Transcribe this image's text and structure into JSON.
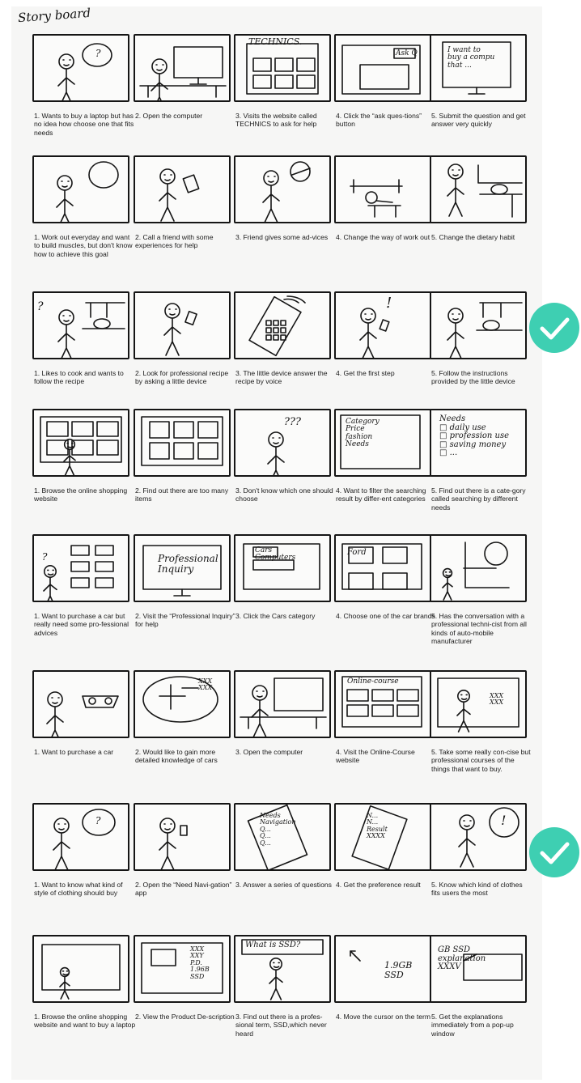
{
  "title": "Story board",
  "rows": [
    {
      "panels": [
        {
          "caption": "1. Wants to buy a laptop but has no idea how choose one that fits needs",
          "text": "?"
        },
        {
          "caption": "2. Open the computer",
          "text": ""
        },
        {
          "caption": "3. Visits the website called TECHNICS to ask for help",
          "text": "TECHNICS."
        },
        {
          "caption": "4. Click the “ask ques-tions” button",
          "text": "Ask Q"
        },
        {
          "caption": "5. Submit the question and get answer very quickly",
          "text": "I want to\nbuy a compu\nthat ..."
        }
      ]
    },
    {
      "panels": [
        {
          "caption": "1. Work out everyday and want to build  muscles, but don't know how to achieve this goal",
          "text": ""
        },
        {
          "caption": "2. Call a friend with some experiences for help",
          "text": ""
        },
        {
          "caption": "3. Friend gives some ad-vices",
          "text": ""
        },
        {
          "caption": "4. Change the way of work out",
          "text": ""
        },
        {
          "caption": "5. Change the dietary habit",
          "text": ""
        }
      ]
    },
    {
      "panels": [
        {
          "caption": "1. Likes to cook and wants to follow the recipe",
          "text": "?"
        },
        {
          "caption": "2. Look for professional recipe by asking a little device",
          "text": ""
        },
        {
          "caption": "3. The little device answer the recipe by voice",
          "text": ""
        },
        {
          "caption": "4. Get the first step",
          "text": "!"
        },
        {
          "caption": "5. Follow the instructions provided by the little device",
          "text": ""
        }
      ]
    },
    {
      "panels": [
        {
          "caption": "1. Browse the online shopping website",
          "text": ""
        },
        {
          "caption": "2. Find out there are too many items",
          "text": ""
        },
        {
          "caption": "3. Don't know which one should choose",
          "text": "???"
        },
        {
          "caption": "4. Want to filter the searching result by differ-ent categories",
          "text": "Category\nPrice\nfashion\nNeeds"
        },
        {
          "caption": "5. Find out there is a cate-gory called searching by different needs",
          "text": "Needs\n□ daily use\n□ profession use\n□ saving money\n□ ..."
        }
      ]
    },
    {
      "panels": [
        {
          "caption": "1. Want to purchase a car but really need some pro-fessional advices",
          "text": "?"
        },
        {
          "caption": "2. Visit the “Professional Inquiry” for help",
          "text": "Professional\nInquiry"
        },
        {
          "caption": "3. Click the Cars category",
          "text": "Cars\nComputers"
        },
        {
          "caption": "4. Choose one of the car brands",
          "text": "Ford"
        },
        {
          "caption": "5. Has the conversation with a professional techni-cist from all kinds of auto-mobile manufacturer",
          "text": ""
        }
      ]
    },
    {
      "panels": [
        {
          "caption": "1. Want to purchase a car",
          "text": ""
        },
        {
          "caption": "2. Would like to gain more detailed knowledge of cars",
          "text": "XXX\nXXX"
        },
        {
          "caption": "3. Open the computer",
          "text": ""
        },
        {
          "caption": "4. Visit the Online-Course website",
          "text": "Online-course"
        },
        {
          "caption": "5. Take some really con-cise but professional courses of the things that want to buy.",
          "text": "XXX\nXXX"
        }
      ]
    },
    {
      "panels": [
        {
          "caption": "1. Want to know what kind of style of clothing should buy",
          "text": "?"
        },
        {
          "caption": "2. Open the “Need Navi-gation” app",
          "text": ""
        },
        {
          "caption": "3. Answer a series of questions",
          "text": "Needs\nNavigation\nQ...\nQ...\nQ..."
        },
        {
          "caption": "4. Get the preference result",
          "text": "N...\nN...\nResult\nXXXX"
        },
        {
          "caption": "5. Know which kind of clothes fits users the most",
          "text": "!"
        }
      ]
    },
    {
      "panels": [
        {
          "caption": "1. Browse the online shopping website and want to buy a laptop",
          "text": ""
        },
        {
          "caption": "2. View the Product De-scription",
          "text": "XXX\nXXY\nP.D.\n1.96B\nSSD"
        },
        {
          "caption": "3. Find out there is a profes-sional term, SSD,which never heard",
          "text": "What is SSD?"
        },
        {
          "caption": "4. Move the cursor on the term",
          "text": "1.9GB\nSSD"
        },
        {
          "caption": "5. Get the explanations immediately from a pop-up window",
          "text": "GB SSD\nexplanation\nXXXV"
        }
      ]
    }
  ],
  "checkmarks": [
    {
      "row": 3
    },
    {
      "row": 7
    }
  ],
  "colors": {
    "ink": "#151515",
    "check": "#3ecfb2",
    "paper": "#f6f6f5"
  }
}
